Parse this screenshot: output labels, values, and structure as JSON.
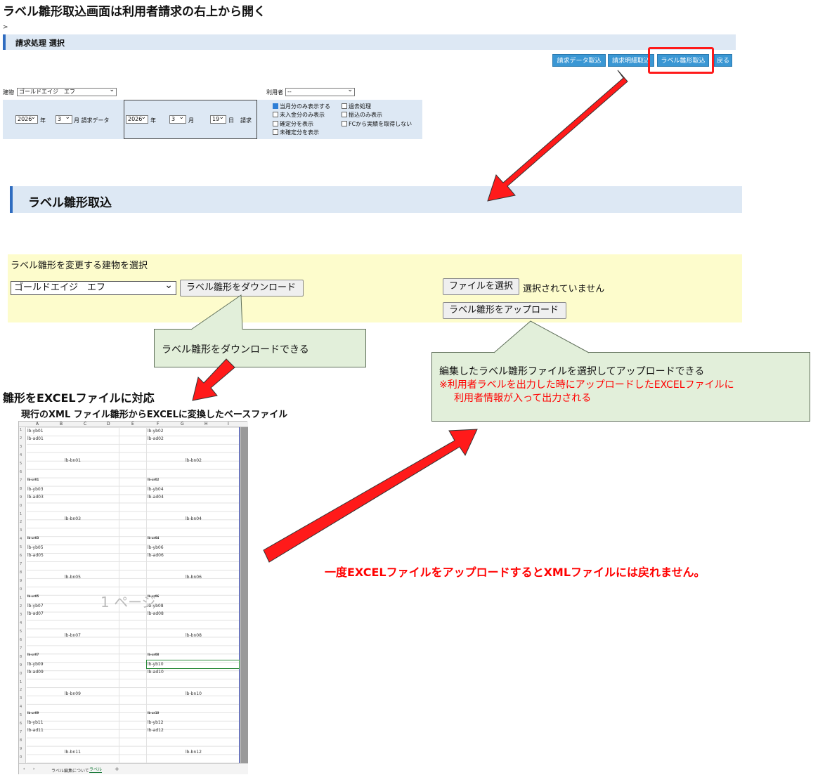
{
  "page": {
    "top_heading": "ラベル雛形取込画面は利用者請求の右上から開く",
    "breadcrumb": ">",
    "section_title": "請求処理 選択",
    "import_title": "ラベル雛形取込"
  },
  "toolbar": {
    "buttons": [
      "請求データ取込",
      "請求明細取込",
      "ラベル雛形取込",
      "戻る"
    ]
  },
  "filters": {
    "building_label": "建物",
    "building_value": "ゴールドエイジ　エフ",
    "user_label": "利用者",
    "user_value": "--",
    "billing_year": "2026",
    "year_unit": "年",
    "billing_month": "3",
    "month_unit_data": "月 請求データ",
    "bill_year": "2026",
    "bill_month": "3",
    "month_unit": "月",
    "bill_day": "19",
    "day_unit": "日",
    "bill_label": "請求",
    "checkboxes": [
      {
        "label": "当月分のみ表示する",
        "checked": true
      },
      {
        "label": "過去処理",
        "checked": false
      },
      {
        "label": "未入金分のみ表示",
        "checked": false
      },
      {
        "label": "振込のみ表示",
        "checked": false
      },
      {
        "label": "確定分を表示",
        "checked": false
      },
      {
        "label": "FCから実績を取得しない",
        "checked": false
      },
      {
        "label": "未確定分を表示",
        "checked": false
      }
    ]
  },
  "import_panel": {
    "prompt": "ラベル雛形を変更する建物を選択",
    "building_value": "ゴールドエイジ　エフ",
    "download_button": "ラベル雛形をダウンロード",
    "file_button": "ファイルを選択",
    "file_status": "選択されていません",
    "upload_button": "ラベル雛形をアップロード"
  },
  "notes": {
    "download_callout": "ラベル雛形をダウンロードできる",
    "upload_callout": "編集したラベル雛形ファイルを選択してアップロードできる",
    "upload_note_1": "※利用者ラベルを出力した時にアップロードしたEXCELファイルに",
    "upload_note_2": "利用者情報が入って出力される",
    "excel_heading": "雛形をEXCELファイルに対応",
    "excel_sub": "現行のXML ファイル雛形からEXCELに変換したベースファイル",
    "warning": "一度EXCELファイルをアップロードするとXMLファイルには戻れません。"
  },
  "sheet": {
    "col_headers": [
      "A",
      "B",
      "C",
      "D",
      "E",
      "F",
      "G",
      "H",
      "I"
    ],
    "page_watermark": "1 ページ",
    "tabs": [
      "ラベル編集について",
      "ラベル"
    ],
    "add_tab": "+",
    "blocks": [
      {
        "row": 1,
        "yb": [
          "lb-yb01",
          "lb-yb02"
        ],
        "ad": [
          "lb-ad01",
          "lb-ad02"
        ],
        "bn": [
          "lb-bn01",
          "lb-bn02"
        ],
        "ur": [
          "lb-ur01",
          "lb-ur02"
        ]
      },
      {
        "row": 2,
        "yb": [
          "lb-yb03",
          "lb-yb04"
        ],
        "ad": [
          "lb-ad03",
          "lb-ad04"
        ],
        "bn": [
          "lb-bn03",
          "lb-bn04"
        ],
        "ur": [
          "lb-ur03",
          "lb-ur04"
        ]
      },
      {
        "row": 3,
        "yb": [
          "lb-yb05",
          "lb-yb06"
        ],
        "ad": [
          "lb-ad05",
          "lb-ad06"
        ],
        "bn": [
          "lb-bn05",
          "lb-bn06"
        ],
        "ur": [
          "lb-ur05",
          "lb-ur06"
        ]
      },
      {
        "row": 4,
        "yb": [
          "lb-yb07",
          "lb-yb08"
        ],
        "ad": [
          "lb-ad07",
          "lb-ad08"
        ],
        "bn": [
          "lb-bn07",
          "lb-bn08"
        ],
        "ur": [
          "lb-ur07",
          "lb-ur08"
        ]
      },
      {
        "row": 5,
        "yb": [
          "lb-yb09",
          "lb-yb10"
        ],
        "ad": [
          "lb-ad09",
          "lb-ad10"
        ],
        "bn": [
          "lb-bn09",
          "lb-bn10"
        ],
        "ur": [
          "lb-ur09",
          "lb-ur10"
        ]
      },
      {
        "row": 6,
        "yb": [
          "lb-yb11",
          "lb-yb12"
        ],
        "ad": [
          "lb-ad11",
          "lb-ad12"
        ],
        "bn": [
          "lb-bn11",
          "lb-bn12"
        ],
        "ur": []
      }
    ]
  },
  "colors": {
    "accent_blue": "#2f6cc0",
    "toolbar_blue": "#3a97d4",
    "highlight_red": "#ff1a1a",
    "panel_yellow": "#fdfccc",
    "callout_green": "#e2efda"
  }
}
